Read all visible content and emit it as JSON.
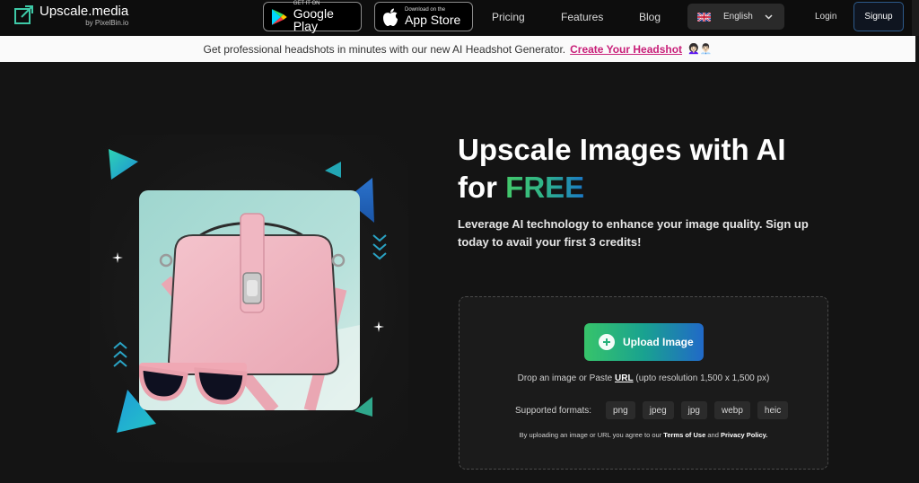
{
  "header": {
    "logo_title": "Upscale.media",
    "logo_sub": "by PixelBin.io",
    "google_play": {
      "small": "GET IT ON",
      "big": "Google Play"
    },
    "app_store": {
      "small": "Download on the",
      "big": "App Store"
    },
    "nav": [
      "Pricing",
      "Features",
      "Blog"
    ],
    "language": "English",
    "login": "Login",
    "signup": "Signup"
  },
  "banner": {
    "text": "Get professional headshots in minutes with our new AI Headshot Generator.",
    "link": "Create Your Headshot",
    "emoji": "👩🏻‍🦱👨🏻‍💼"
  },
  "hero": {
    "title_line1": "Upscale Images with AI",
    "title_for": "for",
    "title_free": "FREE",
    "subtitle": "Leverage AI technology to enhance your image quality. Sign up today to avail your first 3 credits!"
  },
  "upload": {
    "button": "Upload Image",
    "drop_prefix": "Drop an image or Paste",
    "drop_url": "URL",
    "drop_suffix": "(upto resolution 1,500 x 1,500 px)",
    "formats_label": "Supported formats:",
    "formats": [
      "png",
      "jpeg",
      "jpg",
      "webp",
      "heic"
    ],
    "terms_prefix": "By uploading an image or URL you agree to our",
    "terms_link": "Terms of Use",
    "terms_and": "and",
    "privacy_link": "Privacy Policy."
  },
  "colors": {
    "accent_green": "#43c86a",
    "accent_blue": "#1a78c8",
    "banner_link": "#c81e78"
  }
}
